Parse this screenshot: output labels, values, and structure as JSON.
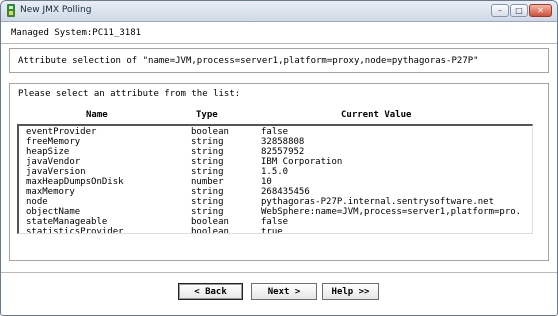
{
  "window": {
    "title": "New JMX Polling",
    "controls": {
      "minimize": "–",
      "maximize": "□",
      "close": "✕"
    }
  },
  "managed_system": "Managed System:PC11_3181",
  "attribute_selection": "Attribute selection of \"name=JVM,process=server1,platform=proxy,node=pythagoras-P27P\"",
  "prompt": "Please select an attribute from the list:",
  "table": {
    "headers": {
      "name": "Name",
      "type": "Type",
      "value": "Current Value"
    },
    "rows": [
      {
        "name": "eventProvider",
        "type": "boolean",
        "value": "false"
      },
      {
        "name": "freeMemory",
        "type": "string",
        "value": "32858808"
      },
      {
        "name": "heapSize",
        "type": "string",
        "value": "82557952"
      },
      {
        "name": "javaVendor",
        "type": "string",
        "value": "IBM Corporation"
      },
      {
        "name": "javaVersion",
        "type": "string",
        "value": "1.5.0"
      },
      {
        "name": "maxHeapDumpsOnDisk",
        "type": "number",
        "value": "10"
      },
      {
        "name": "maxMemory",
        "type": "string",
        "value": "268435456"
      },
      {
        "name": "node",
        "type": "string",
        "value": "pythagoras-P27P.internal.sentrysoftware.net"
      },
      {
        "name": "objectName",
        "type": "string",
        "value": "WebSphere:name=JVM,process=server1,platform=pro..."
      },
      {
        "name": "stateManageable",
        "type": "boolean",
        "value": "false"
      },
      {
        "name": "statisticsProvider",
        "type": "boolean",
        "value": "true"
      }
    ]
  },
  "buttons": {
    "back": "< Back",
    "next": "Next >",
    "help": "Help >>"
  }
}
